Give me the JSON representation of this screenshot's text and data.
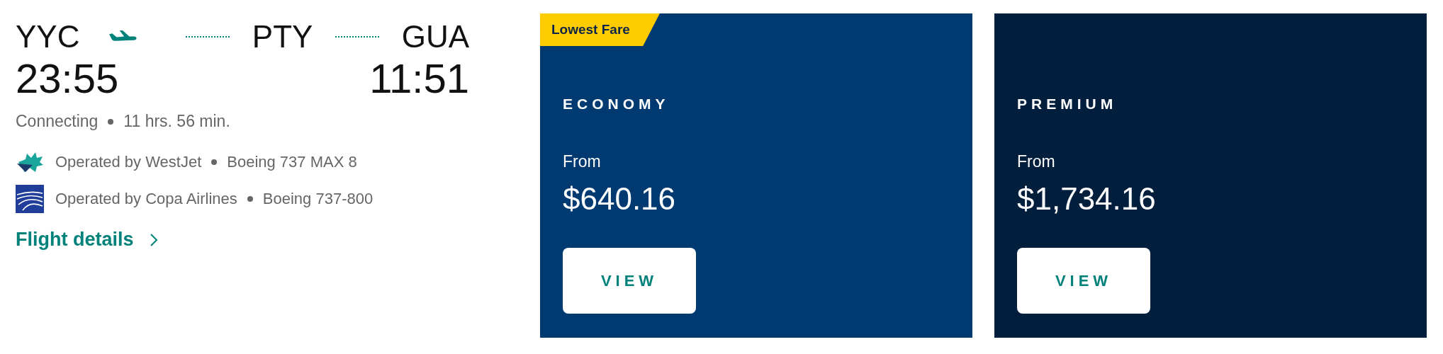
{
  "itinerary": {
    "origin": "YYC",
    "connection": "PTY",
    "destination": "GUA",
    "departure_time": "23:55",
    "arrival_time": "11:51",
    "stop_type": "Connecting",
    "duration": "11 hrs. 56 min.",
    "operators": [
      {
        "kind": "maple",
        "carrier": "Operated by WestJet",
        "aircraft": "Boeing 737 MAX 8"
      },
      {
        "kind": "wings",
        "carrier": "Operated by Copa Airlines",
        "aircraft": "Boeing 737-800"
      }
    ],
    "details_link": "Flight details"
  },
  "fares": [
    {
      "badge": "Lowest Fare",
      "cabin": "ECONOMY",
      "from_label": "From",
      "price": "$640.16",
      "button": "VIEW",
      "color": "#003a70"
    },
    {
      "cabin": "PREMIUM",
      "from_label": "From",
      "price": "$1,734.16",
      "button": "VIEW",
      "color": "#011e3d"
    }
  ]
}
